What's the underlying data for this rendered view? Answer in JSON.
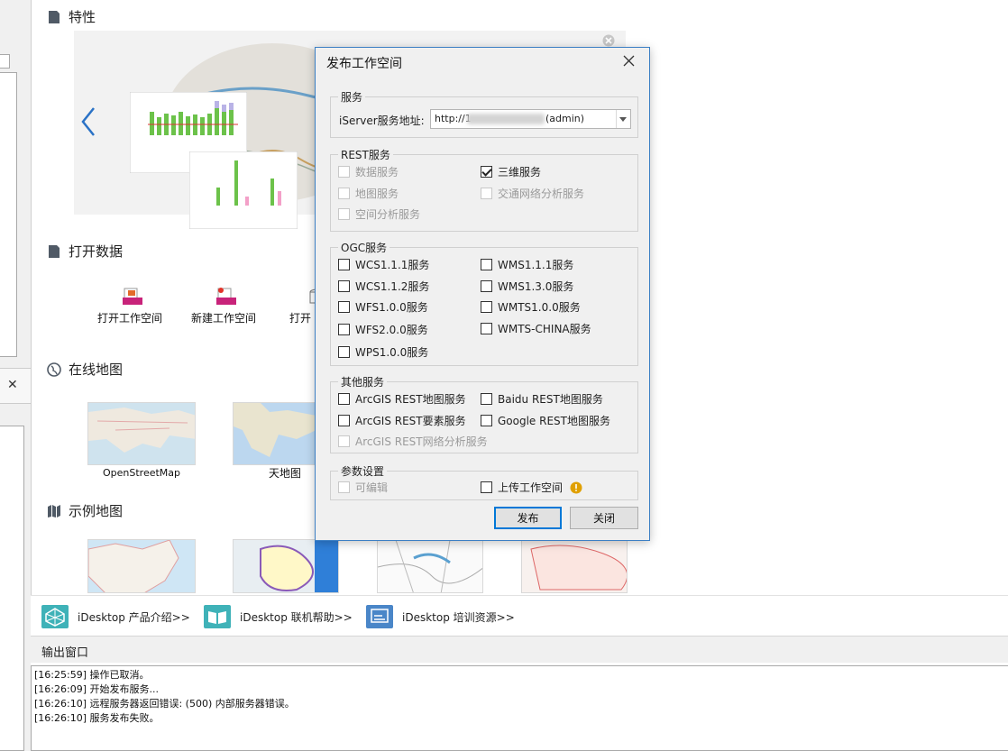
{
  "sections": {
    "features": "特性",
    "open_data": "打开数据",
    "online_map": "在线地图",
    "sample_map": "示例地图"
  },
  "open_data_items": [
    "打开工作空间",
    "新建工作空间",
    "打开"
  ],
  "online_maps": [
    "OpenStreetMap",
    "天地图"
  ],
  "bottom_links": [
    "iDesktop 产品介绍>>",
    "iDesktop 联机帮助>>",
    "iDesktop 培训资源>>"
  ],
  "output": {
    "title": "输出窗口",
    "logs": [
      "[16:25:59] 操作已取消。",
      "[16:26:09] 开始发布服务...",
      "[16:26:10] 远程服务器返回错误: (500) 内部服务器错误。",
      "[16:26:10] 服务发布失败。"
    ]
  },
  "dialog": {
    "title": "发布工作空间",
    "service_group": "服务",
    "iserver_label": "iServer服务地址:",
    "iserver_value_prefix": "http://1",
    "iserver_value_suffix": "(admin)",
    "rest_group": "REST服务",
    "rest": {
      "data": "数据服务",
      "3d": "三维服务",
      "map": "地图服务",
      "transport": "交通网络分析服务",
      "spatial": "空间分析服务"
    },
    "ogc_group": "OGC服务",
    "ogc": {
      "wcs111": "WCS1.1.1服务",
      "wms111": "WMS1.1.1服务",
      "wcs112": "WCS1.1.2服务",
      "wms130": "WMS1.3.0服务",
      "wfs100": "WFS1.0.0服务",
      "wmts100": "WMTS1.0.0服务",
      "wfs200": "WFS2.0.0服务",
      "wmtschina": "WMTS-CHINA服务",
      "wps100": "WPS1.0.0服务"
    },
    "other_group": "其他服务",
    "other": {
      "arcgis_map": "ArcGIS REST地图服务",
      "baidu": "Baidu REST地图服务",
      "arcgis_feature": "ArcGIS REST要素服务",
      "google": "Google REST地图服务",
      "arcgis_network": "ArcGIS REST网络分析服务"
    },
    "param_group": "参数设置",
    "params": {
      "editable": "可编辑",
      "upload": "上传工作空间"
    },
    "publish_button": "发布",
    "close_button": "关闭"
  },
  "colors": {
    "accent": "#0078d7",
    "dialog_border": "#3c7fc4",
    "warning": "#e0a000"
  }
}
